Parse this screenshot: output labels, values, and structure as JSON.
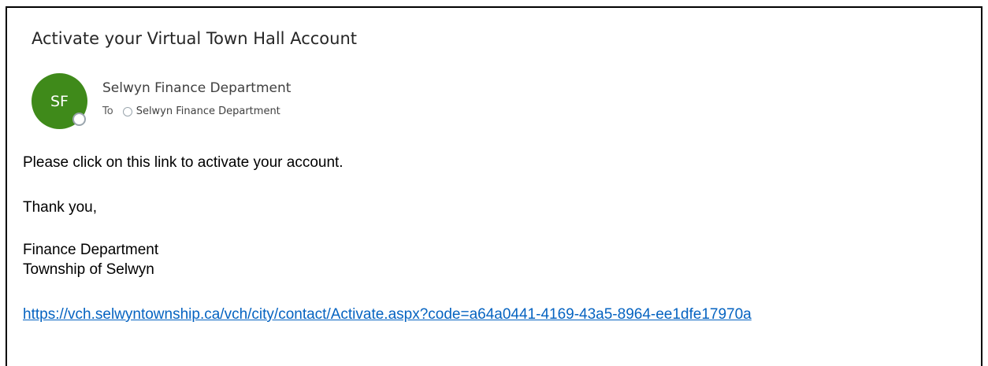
{
  "email": {
    "subject": "Activate your Virtual Town Hall Account",
    "sender": {
      "initials": "SF",
      "name": "Selwyn Finance Department",
      "avatar_color": "#3f8a1a"
    },
    "to_label": "To",
    "recipient": "Selwyn Finance Department",
    "body": {
      "line1": "Please click on this link to activate your account.",
      "line2": "Thank you,",
      "signature_line1": "Finance Department",
      "signature_line2": "Township of Selwyn"
    },
    "link": "https://vch.selwyntownship.ca/vch/city/contact/Activate.aspx?code=a64a0441-4169-43a5-8964-ee1dfe17970a",
    "link_color": "#0563c1"
  }
}
